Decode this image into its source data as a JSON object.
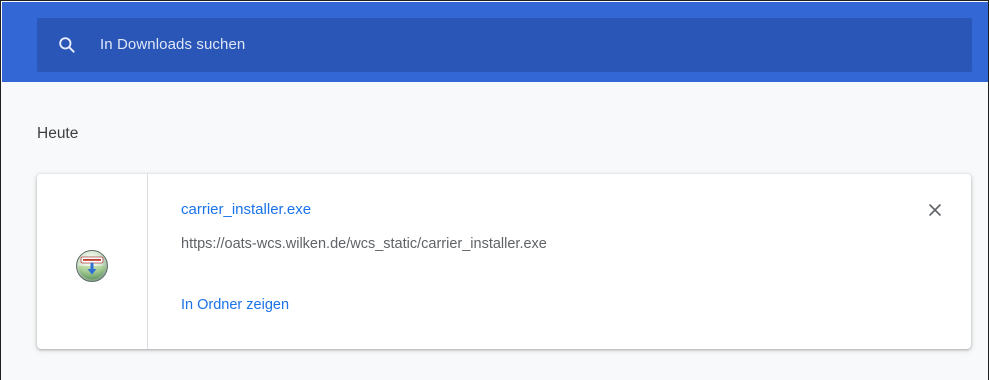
{
  "header": {
    "search": {
      "icon": "search-icon",
      "placeholder": "In Downloads suchen"
    },
    "bg_color": "#3367d6",
    "search_bg_color": "#2a56b8"
  },
  "downloads": {
    "section_title": "Heute",
    "items": [
      {
        "icon": "installer-file-icon",
        "file_name": "carrier_installer.exe",
        "url": "https://oats-wcs.wilken.de/wcs_static/carrier_installer.exe",
        "action_label": "In Ordner zeigen",
        "remove_icon": "close-icon"
      }
    ]
  },
  "colors": {
    "link": "#1a73e8",
    "text_secondary": "#5f6368"
  }
}
